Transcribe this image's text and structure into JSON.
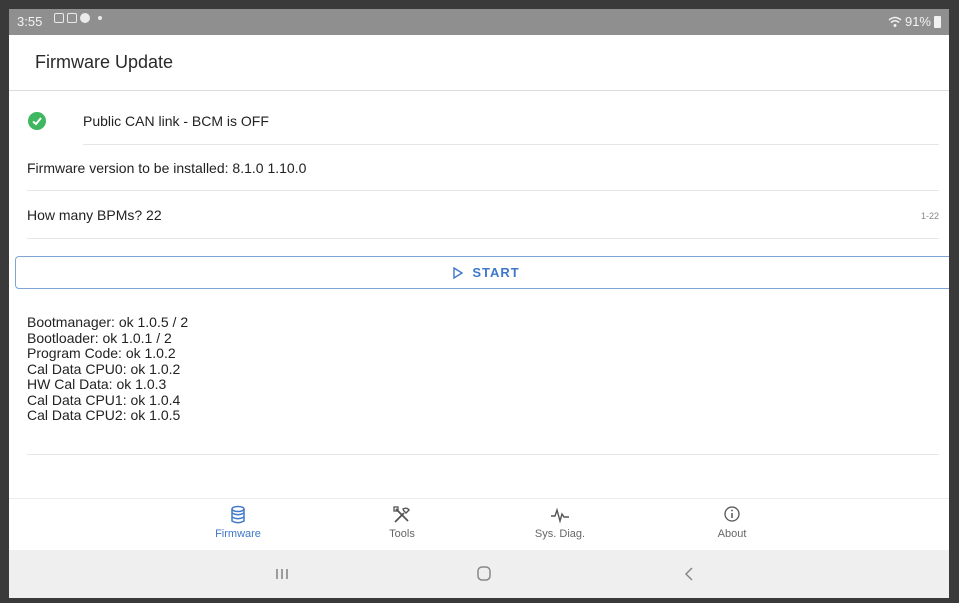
{
  "status_bar": {
    "time": "3:55",
    "battery": "91%",
    "icons": [
      "notification-icon",
      "media-icon",
      "app-icon",
      "wifi-icon",
      "battery-icon"
    ]
  },
  "app_bar": {
    "title": "Firmware Update"
  },
  "can_status": {
    "label": "Public CAN link - BCM is OFF",
    "icon": "check-circle-icon",
    "color": "#3fb660"
  },
  "firmware_version": {
    "label": "Firmware version to be installed: 8.1.0 1.10.0"
  },
  "bpm": {
    "label": "How many BPMs?",
    "value": "22",
    "range": "1-22"
  },
  "start_button": {
    "label": "START",
    "icon": "play-outline-icon",
    "color": "#3f78c8"
  },
  "results": [
    "Bootmanager: ok 1.0.5 / 2",
    "Bootloader: ok 1.0.1 / 2",
    "Program Code: ok 1.0.2",
    "Cal Data CPU0: ok 1.0.2",
    "HW Cal Data: ok 1.0.3",
    "Cal Data CPU1: ok 1.0.4",
    "Cal Data CPU2: ok 1.0.5"
  ],
  "bottom_nav": [
    {
      "label": "Firmware",
      "icon": "database-icon",
      "active": true
    },
    {
      "label": "Tools",
      "icon": "tools-icon",
      "active": false
    },
    {
      "label": "Sys. Diag.",
      "icon": "pulse-icon",
      "active": false
    },
    {
      "label": "About",
      "icon": "info-icon",
      "active": false
    }
  ],
  "system_nav": [
    "recents-icon",
    "home-icon",
    "back-icon"
  ]
}
